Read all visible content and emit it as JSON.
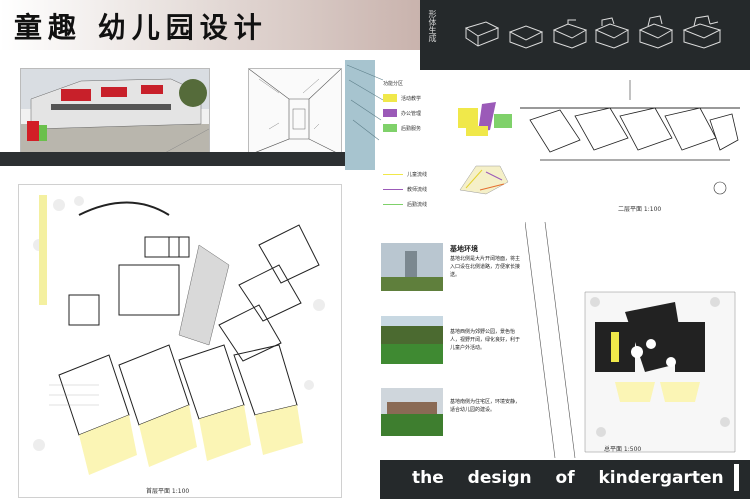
{
  "header": {
    "title": "童趣 幼儿园设计",
    "vertical_label": "形体生成"
  },
  "legend": {
    "zones": [
      {
        "label": "活动教学",
        "color": "#f0e84a"
      },
      {
        "label": "办公管理",
        "color": "#9b5ab8"
      },
      {
        "label": "后勤服务",
        "color": "#7fd16a"
      }
    ],
    "lines": [
      {
        "label": "儿童流线",
        "color": "#f0e84a"
      },
      {
        "label": "教师流线",
        "color": "#9b5ab8"
      },
      {
        "label": "后勤流线",
        "color": "#7fd16a"
      }
    ],
    "zone_heading": "功能分区"
  },
  "plan_labels": {
    "second_floor": "二层平面 1:100",
    "first_floor": "首层平面 1:100",
    "site_plan": "总平面 1:500"
  },
  "site": {
    "title": "基地环境",
    "paragraphs": [
      "基地北侧是大片开阔地面，将主入口设在北侧道路，方便家长接送。",
      "基地西侧为郊野公园，景色怡人，视野开阔，绿化良好，利于儿童户外活动。",
      "基地南侧为住宅区，环境安静，适合幼儿园的建设。"
    ]
  },
  "footer": {
    "english_title": "the design of kindergarten"
  }
}
